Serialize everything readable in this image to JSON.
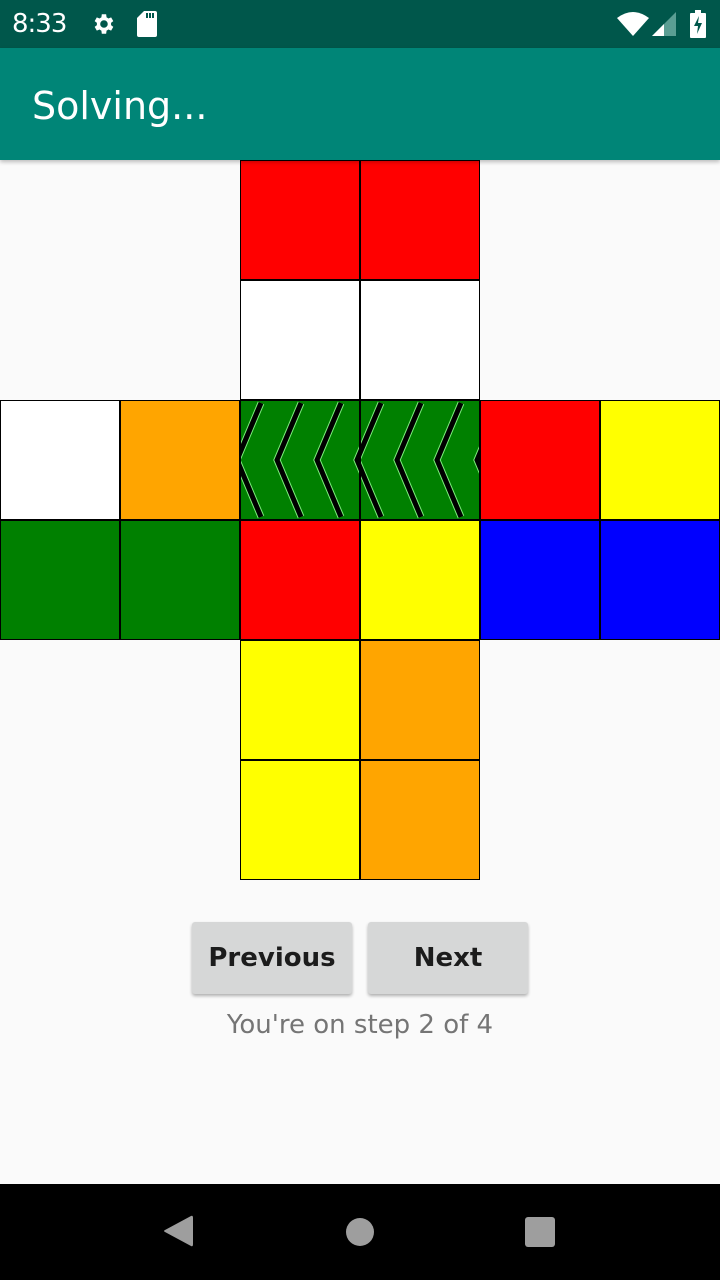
{
  "status_bar": {
    "time": "8:33",
    "icons": [
      "gear-icon",
      "sd-card-icon",
      "wifi-icon",
      "cell-signal-icon",
      "battery-charging-icon"
    ]
  },
  "app_bar": {
    "title": "Solving..."
  },
  "colors": {
    "red": "#ff0000",
    "white": "#ffffff",
    "orange": "#ffa500",
    "green": "#008000",
    "yellow": "#ffff00",
    "blue": "#0000ff",
    "status_bar": "#00574b",
    "app_bar": "#008577"
  },
  "cube": {
    "tiles": [
      {
        "face": "top",
        "row": 0,
        "col": 2,
        "color": "red"
      },
      {
        "face": "top",
        "row": 0,
        "col": 3,
        "color": "red"
      },
      {
        "face": "top",
        "row": 1,
        "col": 2,
        "color": "white"
      },
      {
        "face": "top",
        "row": 1,
        "col": 3,
        "color": "white"
      },
      {
        "face": "left",
        "row": 2,
        "col": 0,
        "color": "white"
      },
      {
        "face": "left",
        "row": 2,
        "col": 1,
        "color": "orange"
      },
      {
        "face": "front",
        "row": 2,
        "col": 2,
        "color": "green",
        "arrow": "left"
      },
      {
        "face": "front",
        "row": 2,
        "col": 3,
        "color": "green",
        "arrow": "left"
      },
      {
        "face": "right",
        "row": 2,
        "col": 4,
        "color": "red"
      },
      {
        "face": "right",
        "row": 2,
        "col": 5,
        "color": "yellow"
      },
      {
        "face": "left",
        "row": 3,
        "col": 0,
        "color": "green"
      },
      {
        "face": "left",
        "row": 3,
        "col": 1,
        "color": "green"
      },
      {
        "face": "front",
        "row": 3,
        "col": 2,
        "color": "red"
      },
      {
        "face": "front",
        "row": 3,
        "col": 3,
        "color": "yellow"
      },
      {
        "face": "right",
        "row": 3,
        "col": 4,
        "color": "blue"
      },
      {
        "face": "right",
        "row": 3,
        "col": 5,
        "color": "blue"
      },
      {
        "face": "bottom",
        "row": 4,
        "col": 2,
        "color": "yellow"
      },
      {
        "face": "bottom",
        "row": 4,
        "col": 3,
        "color": "orange"
      },
      {
        "face": "bottom",
        "row": 5,
        "col": 2,
        "color": "yellow"
      },
      {
        "face": "bottom",
        "row": 5,
        "col": 3,
        "color": "orange"
      }
    ]
  },
  "controls": {
    "previous_label": "Previous",
    "next_label": "Next",
    "step_text": "You're on step 2 of 4",
    "current_step": 2,
    "total_steps": 4
  },
  "nav_bar": {
    "icons": [
      "back-icon",
      "home-icon",
      "recents-icon"
    ]
  }
}
